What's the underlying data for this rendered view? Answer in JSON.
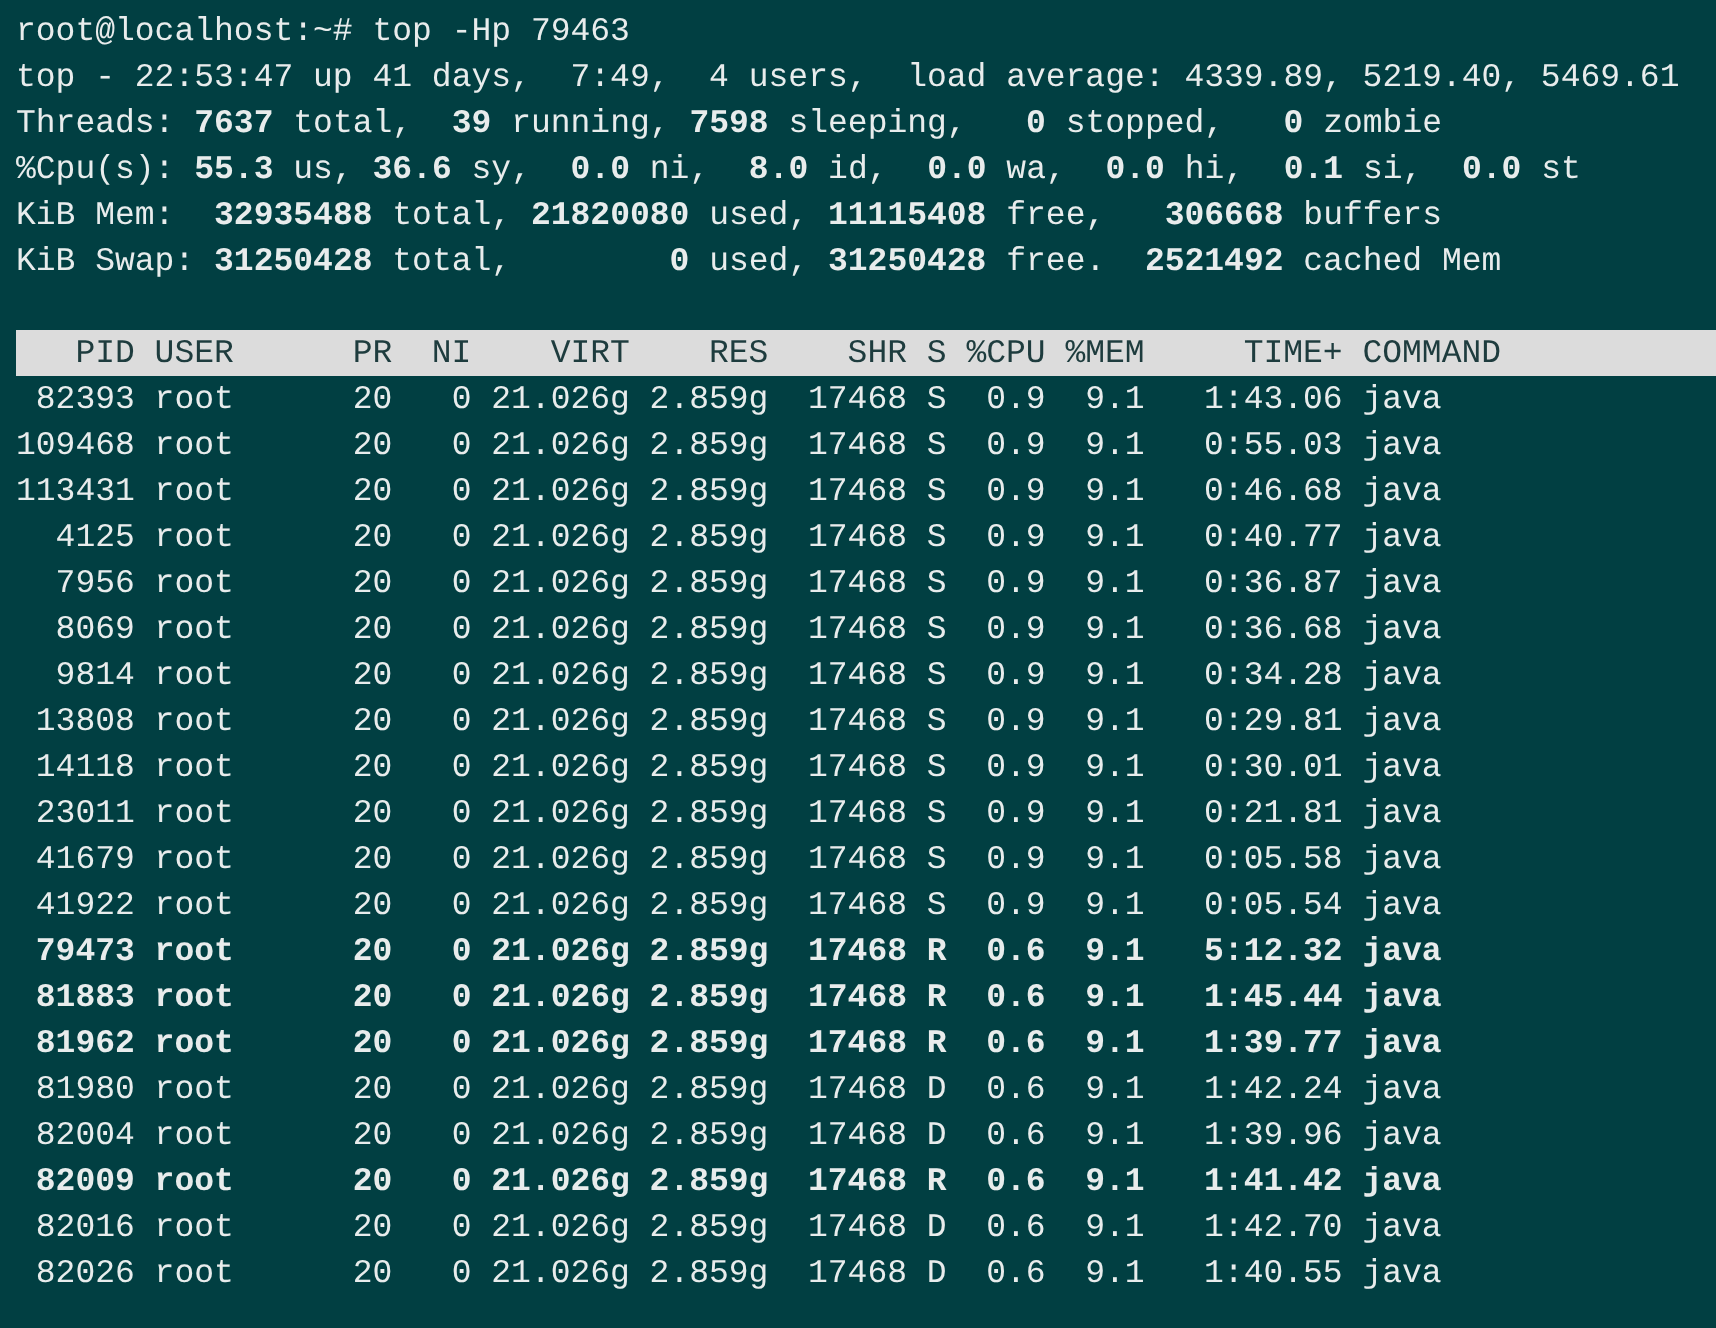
{
  "prompt": "root@localhost:~# top -Hp 79463",
  "summary": [
    "top - 22:53:47 up 41 days,  7:49,  4 users,  load average: 4339.89, 5219.40, 5469.61",
    "Threads: **7637** total,  **39** running, **7598** sleeping,   **0** stopped,   **0** zombie",
    "%Cpu(s): **55.3** us, **36.6** sy,  **0.0** ni,  **8.0** id,  **0.0** wa,  **0.0** hi,  **0.1** si,  **0.0** st",
    "KiB Mem:  **32935488** total, **21820080** used, **11115408** free,   **306668** buffers",
    "KiB Swap: **31250428** total,        **0** used, **31250428** free.  **2521492** cached Mem"
  ],
  "table": {
    "columns": [
      "PID",
      "USER",
      "PR",
      "NI",
      "VIRT",
      "RES",
      "SHR",
      "S",
      "%CPU",
      "%MEM",
      "TIME+",
      "COMMAND"
    ],
    "rows": [
      {
        "bold": false,
        "cells": [
          "82393",
          "root",
          "20",
          "0",
          "21.026g",
          "2.859g",
          "17468",
          "S",
          "0.9",
          "9.1",
          "1:43.06",
          "java"
        ]
      },
      {
        "bold": false,
        "cells": [
          "109468",
          "root",
          "20",
          "0",
          "21.026g",
          "2.859g",
          "17468",
          "S",
          "0.9",
          "9.1",
          "0:55.03",
          "java"
        ]
      },
      {
        "bold": false,
        "cells": [
          "113431",
          "root",
          "20",
          "0",
          "21.026g",
          "2.859g",
          "17468",
          "S",
          "0.9",
          "9.1",
          "0:46.68",
          "java"
        ]
      },
      {
        "bold": false,
        "cells": [
          "4125",
          "root",
          "20",
          "0",
          "21.026g",
          "2.859g",
          "17468",
          "S",
          "0.9",
          "9.1",
          "0:40.77",
          "java"
        ]
      },
      {
        "bold": false,
        "cells": [
          "7956",
          "root",
          "20",
          "0",
          "21.026g",
          "2.859g",
          "17468",
          "S",
          "0.9",
          "9.1",
          "0:36.87",
          "java"
        ]
      },
      {
        "bold": false,
        "cells": [
          "8069",
          "root",
          "20",
          "0",
          "21.026g",
          "2.859g",
          "17468",
          "S",
          "0.9",
          "9.1",
          "0:36.68",
          "java"
        ]
      },
      {
        "bold": false,
        "cells": [
          "9814",
          "root",
          "20",
          "0",
          "21.026g",
          "2.859g",
          "17468",
          "S",
          "0.9",
          "9.1",
          "0:34.28",
          "java"
        ]
      },
      {
        "bold": false,
        "cells": [
          "13808",
          "root",
          "20",
          "0",
          "21.026g",
          "2.859g",
          "17468",
          "S",
          "0.9",
          "9.1",
          "0:29.81",
          "java"
        ]
      },
      {
        "bold": false,
        "cells": [
          "14118",
          "root",
          "20",
          "0",
          "21.026g",
          "2.859g",
          "17468",
          "S",
          "0.9",
          "9.1",
          "0:30.01",
          "java"
        ]
      },
      {
        "bold": false,
        "cells": [
          "23011",
          "root",
          "20",
          "0",
          "21.026g",
          "2.859g",
          "17468",
          "S",
          "0.9",
          "9.1",
          "0:21.81",
          "java"
        ]
      },
      {
        "bold": false,
        "cells": [
          "41679",
          "root",
          "20",
          "0",
          "21.026g",
          "2.859g",
          "17468",
          "S",
          "0.9",
          "9.1",
          "0:05.58",
          "java"
        ]
      },
      {
        "bold": false,
        "cells": [
          "41922",
          "root",
          "20",
          "0",
          "21.026g",
          "2.859g",
          "17468",
          "S",
          "0.9",
          "9.1",
          "0:05.54",
          "java"
        ]
      },
      {
        "bold": true,
        "cells": [
          "79473",
          "root",
          "20",
          "0",
          "21.026g",
          "2.859g",
          "17468",
          "R",
          "0.6",
          "9.1",
          "5:12.32",
          "java"
        ]
      },
      {
        "bold": true,
        "cells": [
          "81883",
          "root",
          "20",
          "0",
          "21.026g",
          "2.859g",
          "17468",
          "R",
          "0.6",
          "9.1",
          "1:45.44",
          "java"
        ]
      },
      {
        "bold": true,
        "cells": [
          "81962",
          "root",
          "20",
          "0",
          "21.026g",
          "2.859g",
          "17468",
          "R",
          "0.6",
          "9.1",
          "1:39.77",
          "java"
        ]
      },
      {
        "bold": false,
        "cells": [
          "81980",
          "root",
          "20",
          "0",
          "21.026g",
          "2.859g",
          "17468",
          "D",
          "0.6",
          "9.1",
          "1:42.24",
          "java"
        ]
      },
      {
        "bold": false,
        "cells": [
          "82004",
          "root",
          "20",
          "0",
          "21.026g",
          "2.859g",
          "17468",
          "D",
          "0.6",
          "9.1",
          "1:39.96",
          "java"
        ]
      },
      {
        "bold": true,
        "cells": [
          "82009",
          "root",
          "20",
          "0",
          "21.026g",
          "2.859g",
          "17468",
          "R",
          "0.6",
          "9.1",
          "1:41.42",
          "java"
        ]
      },
      {
        "bold": false,
        "cells": [
          "82016",
          "root",
          "20",
          "0",
          "21.026g",
          "2.859g",
          "17468",
          "D",
          "0.6",
          "9.1",
          "1:42.70",
          "java"
        ]
      },
      {
        "bold": false,
        "cells": [
          "82026",
          "root",
          "20",
          "0",
          "21.026g",
          "2.859g",
          "17468",
          "D",
          "0.6",
          "9.1",
          "1:40.55",
          "java"
        ]
      }
    ]
  }
}
